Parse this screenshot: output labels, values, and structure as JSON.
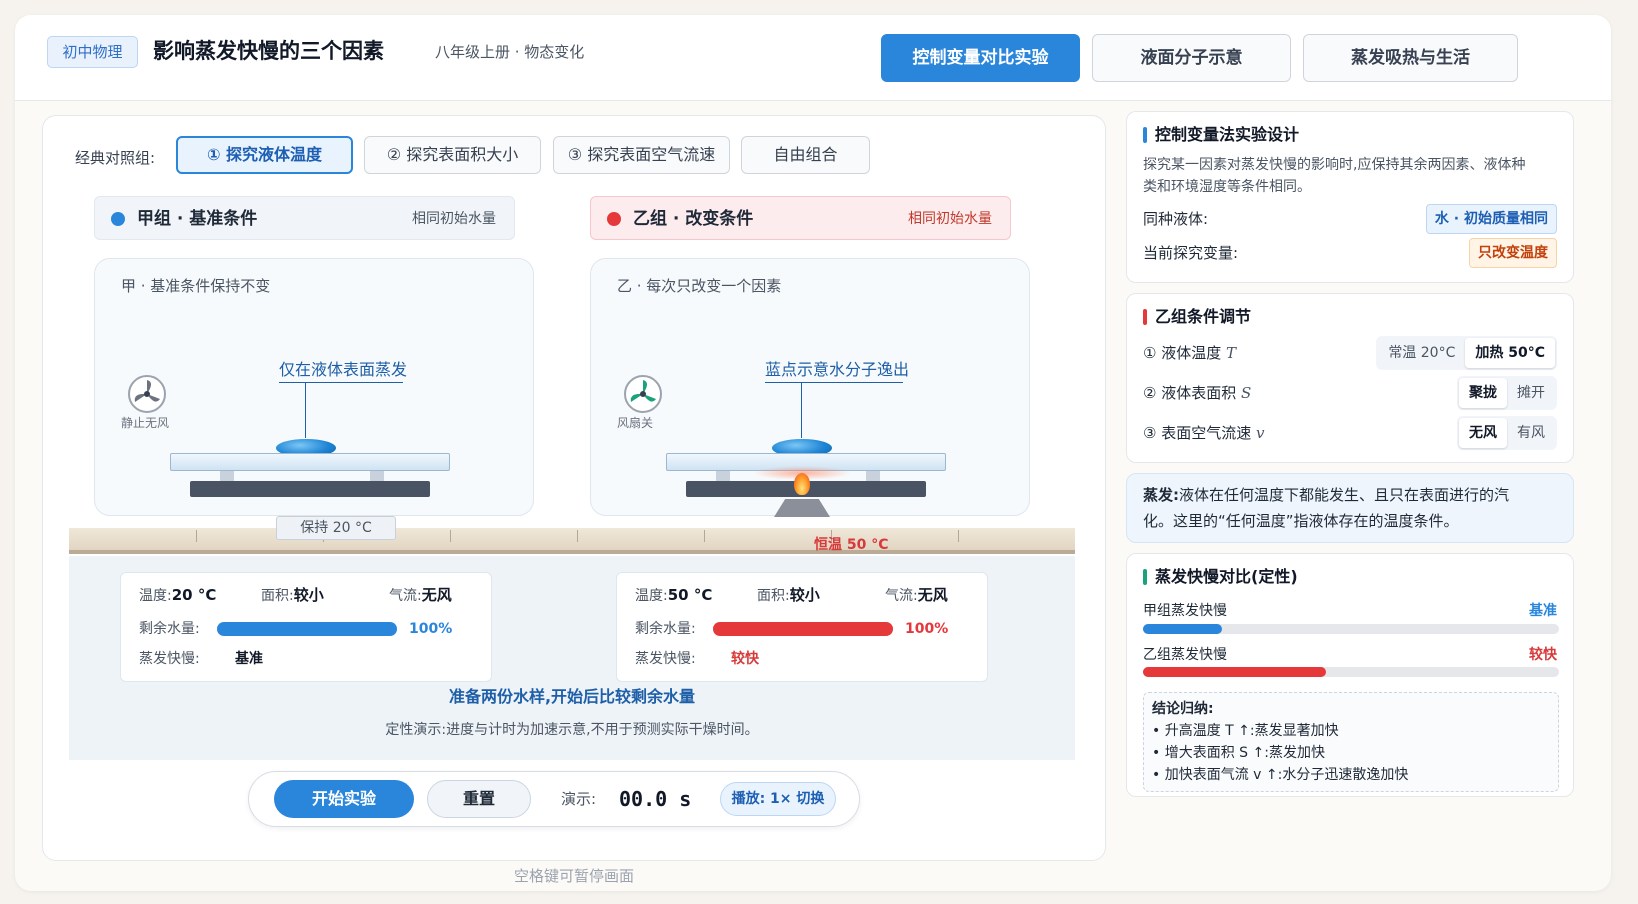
{
  "header": {
    "subject_badge": "初中物理",
    "title": "影响蒸发快慢的三个因素",
    "subtitle": "八年级上册 · 物态变化",
    "tabs": [
      {
        "label": "控制变量对比实验",
        "active": true
      },
      {
        "label": "液面分子示意",
        "active": false
      },
      {
        "label": "蒸发吸热与生活",
        "active": false
      }
    ]
  },
  "presets": {
    "label": "经典对照组:",
    "items": [
      {
        "label": "① 探究液体温度",
        "active": true
      },
      {
        "label": "② 探究表面积大小",
        "active": false
      },
      {
        "label": "③ 探究表面空气流速",
        "active": false
      },
      {
        "label": "自由组合",
        "active": false
      }
    ]
  },
  "group_a": {
    "title": "甲组 · 基准条件",
    "note": "相同初始水量",
    "color": "#2a86db",
    "scene_caption": "甲 · 基准条件保持不变",
    "fan_label": "静止无风",
    "callout": "仅在液体表面蒸发",
    "bench_label": "保持 20 °C",
    "temp_label": "温度:",
    "temp_value": "20 °C",
    "area_label": "面积:",
    "area_value": "较小",
    "wind_label": "气流:",
    "wind_value": "无风",
    "water_label": "剩余水量:",
    "water_pct_text": "100%",
    "water_fraction": 1.0,
    "speed_label": "蒸发快慢:",
    "speed_value": "基准",
    "speed_color": "#111827"
  },
  "group_b": {
    "title": "乙组 · 改变条件",
    "note": "相同初始水量",
    "color": "#e5383b",
    "scene_caption": "乙 · 每次只改变一个因素",
    "fan_label": "风扇关",
    "callout": "蓝点示意水分子逸出",
    "bench_label": "恒温 50 °C",
    "temp_label": "温度:",
    "temp_value": "50 °C",
    "area_label": "面积:",
    "area_value": "较小",
    "wind_label": "气流:",
    "wind_value": "无风",
    "water_label": "剩余水量:",
    "water_pct_text": "100%",
    "water_fraction": 1.0,
    "speed_label": "蒸发快慢:",
    "speed_value": "较快",
    "speed_color": "#d63a3a"
  },
  "status_message": "准备两份水样,开始后比较剩余水量",
  "demo_note": "定性演示:进度与计时为加速示意,不用于预测实际干燥时间。",
  "controls": {
    "start_label": "开始实验",
    "reset_label": "重置",
    "demo_label": "演示:",
    "timer": "00.0 s",
    "speed_label": "播放: 1× 切换"
  },
  "space_hint": "空格键可暂停画面",
  "design_card": {
    "title": "控制变量法实验设计",
    "description_1": "探究某一因素对蒸发快慢的影响时,应保持其余两因素、液体种",
    "description_2": "类和环境湿度等条件相同。",
    "same_liquid_label": "同种液体:",
    "same_liquid_value": "水 · 初始质量相同",
    "variable_label": "当前探究变量:",
    "variable_value": "只改变温度"
  },
  "adjust_card": {
    "title": "乙组条件调节",
    "rows": [
      {
        "label": "① 液体温度",
        "symbol": "T",
        "options": [
          "常温 20°C",
          "加热 50°C"
        ],
        "selected": 1
      },
      {
        "label": "② 液体表面积",
        "symbol": "S",
        "options": [
          "聚拢",
          "摊开"
        ],
        "selected": 0
      },
      {
        "label": "③ 表面空气流速",
        "symbol": "v",
        "options": [
          "无风",
          "有风"
        ],
        "selected": 0
      }
    ]
  },
  "definition_card": {
    "term": "蒸发:",
    "text_1": "液体在任何温度下都能发生、且只在表面进行的汽",
    "text_2": "化。这里的“任何温度”指液体存在的温度条件。"
  },
  "compare_card": {
    "title": "蒸发快慢对比(定性)",
    "a_label": "甲组蒸发快慢",
    "a_value": "基准",
    "a_fraction": 0.19,
    "b_label": "乙组蒸发快慢",
    "b_value": "较快",
    "b_fraction": 0.44,
    "conclusion_title": "结论归纳:",
    "conclusions": [
      "• 升高温度 T ↑:蒸发显著加快",
      "• 增大表面积 S ↑:蒸发加快",
      "• 加快表面气流 v ↑:水分子迅速散逸加快"
    ]
  },
  "colors": {
    "accent": "#2a86db",
    "red": "#e5383b",
    "green": "#1aa37a"
  },
  "icons": [
    "fan-icon"
  ]
}
